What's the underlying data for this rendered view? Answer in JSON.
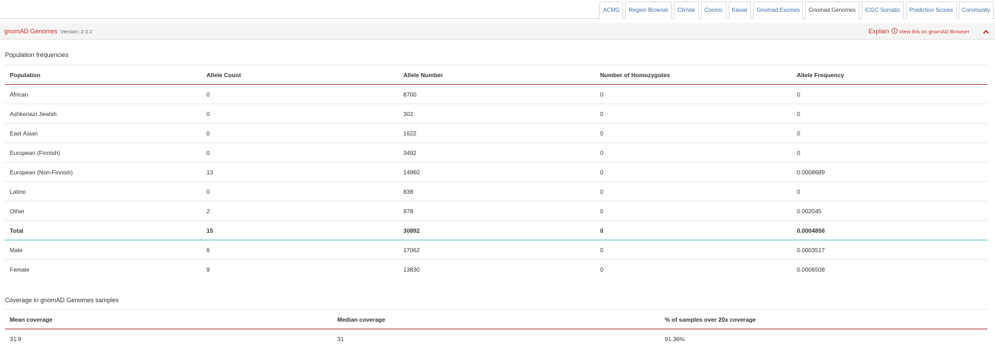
{
  "tabs": [
    {
      "label": "ACMG"
    },
    {
      "label": "Region Browser"
    },
    {
      "label": "ClinVar"
    },
    {
      "label": "Cosmic"
    },
    {
      "label": "Kaviar"
    },
    {
      "label": "Gnomad Exomes"
    },
    {
      "label": "Gnomad Genomes"
    },
    {
      "label": "ICGC Somatic"
    },
    {
      "label": "Prediction Scores"
    },
    {
      "label": "Community"
    }
  ],
  "active_tab": "Gnomad Genomes",
  "panel": {
    "title": "gnomAD Genomes",
    "version": "Version: 2.0.2",
    "explain": "Explain",
    "view_link": "View this on gnomAD Browser"
  },
  "population": {
    "section_title": "Population frequencies",
    "headers": [
      "Population",
      "Allele Count",
      "Allele Number",
      "Number of Homozygotes",
      "Allele Frequency"
    ],
    "rows": [
      [
        "African",
        "0",
        "8700",
        "0",
        "0"
      ],
      [
        "Ashkenazi Jewish",
        "0",
        "302",
        "0",
        "0"
      ],
      [
        "East Asian",
        "0",
        "1622",
        "0",
        "0"
      ],
      [
        "European (Finnish)",
        "0",
        "3492",
        "0",
        "0"
      ],
      [
        "European (Non-Finnish)",
        "13",
        "14960",
        "0",
        "0.0008689"
      ],
      [
        "Latino",
        "0",
        "838",
        "0",
        "0"
      ],
      [
        "Other",
        "2",
        "978",
        "0",
        "0.002045"
      ],
      [
        "Total",
        "15",
        "30892",
        "0",
        "0.0004856"
      ],
      [
        "Male",
        "6",
        "17062",
        "0",
        "0.0003517"
      ],
      [
        "Female",
        "9",
        "13830",
        "0",
        "0.0006508"
      ]
    ]
  },
  "coverage": {
    "section_title": "Coverage in gnomAD Genomes samples",
    "headers": [
      "Mean coverage",
      "Median coverage",
      "% of samples over 20x coverage"
    ],
    "rows": [
      [
        "31.9",
        "31",
        "91.36%"
      ]
    ]
  },
  "colors": {
    "accent_red": "#c9302c",
    "link_blue": "#3a6fb0",
    "header_rule": "#b3353a",
    "total_rule": "#4bbfbf"
  }
}
